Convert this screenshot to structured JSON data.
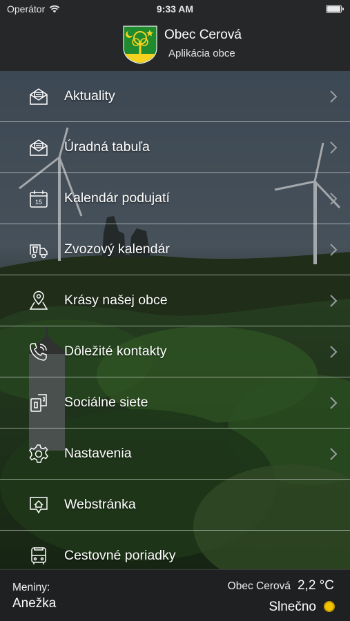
{
  "status_bar": {
    "carrier": "Operátor",
    "time": "9:33 AM",
    "battery_level": 1.0
  },
  "header": {
    "title": "Obec Cerová",
    "subtitle": "Aplikácia obce"
  },
  "menu": {
    "items": [
      {
        "label": "Aktuality",
        "icon": "newsletter-icon",
        "has_chevron": true
      },
      {
        "label": "Úradná tabuľa",
        "icon": "notice-board-icon",
        "has_chevron": true
      },
      {
        "label": "Kalendár podujatí",
        "icon": "calendar-icon",
        "has_chevron": true
      },
      {
        "label": "Zvozový kalendár",
        "icon": "garbage-truck-icon",
        "has_chevron": true
      },
      {
        "label": "Krásy našej obce",
        "icon": "map-pin-icon",
        "has_chevron": true
      },
      {
        "label": "Dôležité kontakty",
        "icon": "phone-icon",
        "has_chevron": true
      },
      {
        "label": "Sociálne siete",
        "icon": "social-network-icon",
        "has_chevron": true
      },
      {
        "label": "Nastavenia",
        "icon": "gear-icon",
        "has_chevron": true
      },
      {
        "label": "Webstránka",
        "icon": "website-icon",
        "has_chevron": false
      },
      {
        "label": "Cestovné poriadky",
        "icon": "bus-icon",
        "has_chevron": false
      }
    ]
  },
  "footer": {
    "nameday_label": "Meniny:",
    "nameday_name": "Anežka",
    "place": "Obec Cerová",
    "temperature": "2,2 °C",
    "weather": "Slnečno",
    "weather_icon": "sun-icon"
  },
  "colors": {
    "header_bg": "#262728",
    "footer_bg": "#1f2021",
    "sun": "#f2c300"
  }
}
